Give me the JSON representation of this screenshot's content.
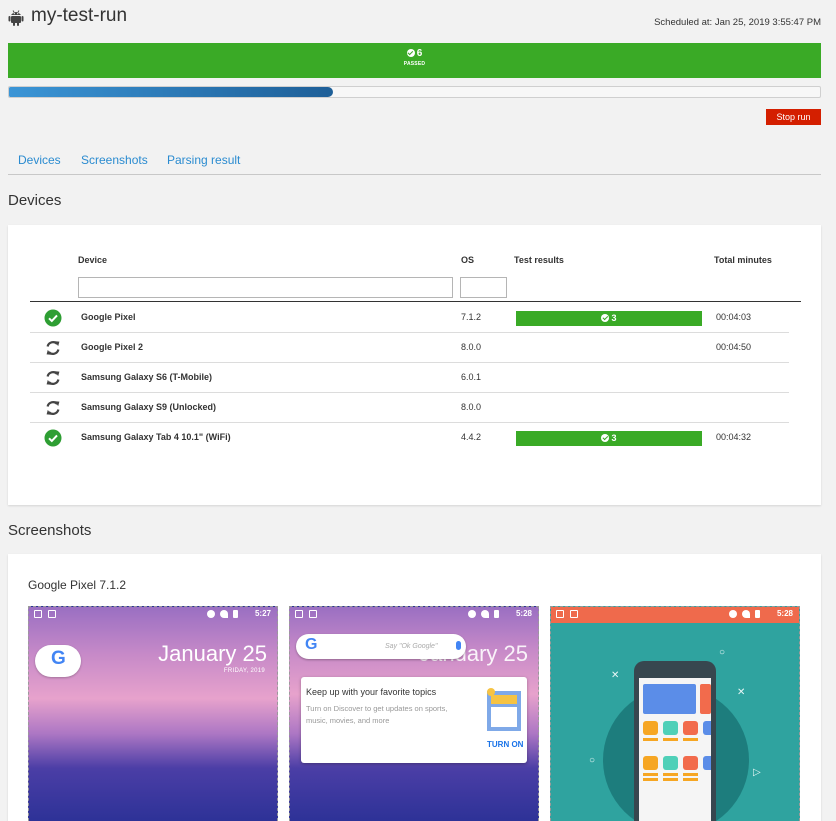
{
  "header": {
    "title": "my-test-run",
    "scheduled": "Scheduled at: Jan 25, 2019 3:55:47 PM"
  },
  "summary": {
    "passed_count": "6",
    "passed_label": "PASSED",
    "progress_fraction": 0.4
  },
  "actions": {
    "stop_label": "Stop run"
  },
  "tabs": [
    {
      "label": "Devices"
    },
    {
      "label": "Screenshots"
    },
    {
      "label": "Parsing result"
    }
  ],
  "devices": {
    "title": "Devices",
    "headers": {
      "device": "Device",
      "os": "OS",
      "results": "Test results",
      "minutes": "Total minutes"
    },
    "rows": [
      {
        "status": "passed",
        "name": "Google Pixel",
        "os": "7.1.2",
        "passed": "3",
        "minutes": "00:04:03"
      },
      {
        "status": "running",
        "name": "Google Pixel 2",
        "os": "8.0.0",
        "passed": "",
        "minutes": "00:04:50"
      },
      {
        "status": "running",
        "name": "Samsung Galaxy S6 (T-Mobile)",
        "os": "6.0.1",
        "passed": "",
        "minutes": ""
      },
      {
        "status": "running",
        "name": "Samsung Galaxy S9 (Unlocked)",
        "os": "8.0.0",
        "passed": "",
        "minutes": ""
      },
      {
        "status": "passed",
        "name": "Samsung Galaxy Tab 4 10.1\" (WiFi)",
        "os": "4.4.2",
        "passed": "3",
        "minutes": "00:04:32"
      }
    ]
  },
  "screenshots": {
    "title": "Screenshots",
    "device_label": "Google Pixel 7.1.2",
    "items": [
      {
        "time": "5:27",
        "g_letter": "G",
        "date": "January 25",
        "day": "FRIDAY, 2019"
      },
      {
        "time": "5:28",
        "g_letter": "G",
        "search_placeholder": "Say \"Ok Google\"",
        "date": "January 25",
        "card_title": "Keep up with your favorite topics",
        "card_body": "Turn on Discover to get updates on sports, music, movies, and more",
        "card_button": "TURN ON"
      },
      {
        "time": "5:28"
      }
    ]
  },
  "colors": {
    "pass_green": "#3aaa26",
    "link_blue": "#2a8bd0",
    "stop_red": "#d41f00"
  }
}
